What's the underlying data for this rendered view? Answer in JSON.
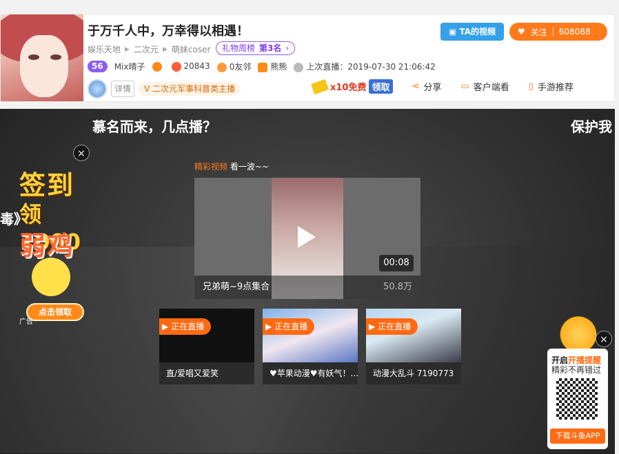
{
  "header": {
    "title": "于万千人中，万幸得以相遇！",
    "breadcrumbs": [
      "娱乐天地",
      "二次元",
      "萌妹coser"
    ],
    "rank": {
      "label": "礼物周榜",
      "value": "第3名"
    },
    "level": "56",
    "nickname": "Mix晴子",
    "hot": "20843",
    "friends": "0友邻",
    "guild": "熊熊",
    "last_live": "上次直播：2019-07-30 21:06:42",
    "detail": "详情",
    "tag": "二次元军事科普类主播",
    "ta_video": "TA的视频",
    "follow": {
      "label": "关注",
      "count": "608088"
    },
    "free_gift": {
      "count": "x10免费",
      "action": "领取"
    },
    "share": "分享",
    "client": "客户端看",
    "mobile": "手游推荐"
  },
  "stage": {
    "headline_left": "慕名而来，几点播？",
    "headline_right": "保护我",
    "edge_text": "毒》",
    "featured": {
      "label_hl": "精彩视频",
      "label": "看一波~~",
      "duration": "00:08",
      "title": "兄弟萌~9点集合",
      "views": "50.8万"
    },
    "live_badge": "正在直播",
    "live_cards": [
      {
        "caption": "直/爱唱又爱笑"
      },
      {
        "caption": "♥苹果动漫♥有妖气！..."
      },
      {
        "caption": "动漫大乱斗 7190773"
      }
    ]
  },
  "ad_left": {
    "line1": "签到",
    "line2": "领1000",
    "line3": "弱鸡",
    "claim": "点击领取",
    "ad_label": "广告",
    "close": "×"
  },
  "ad_right": {
    "line1_prefix": "开启",
    "line1_hl": "开播提醒",
    "line2": "精彩不再错过",
    "download": "下载斗鱼APP",
    "close": "×"
  },
  "colors": {
    "accent": "#ff7a1a",
    "purple": "#8b5cf6",
    "blue": "#34a0e8"
  }
}
